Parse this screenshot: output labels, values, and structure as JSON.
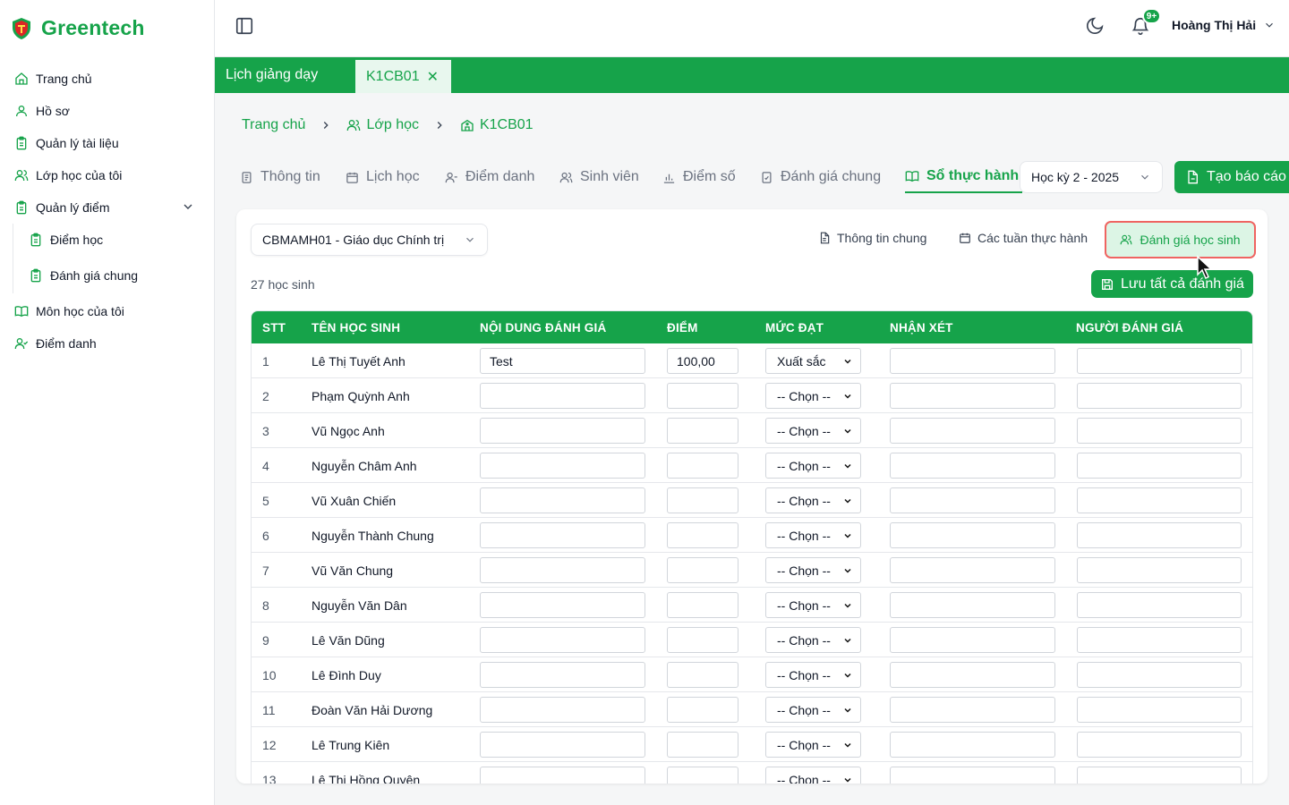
{
  "app": {
    "brand": "Greentech"
  },
  "sidebar": {
    "items": [
      {
        "label": "Trang chủ",
        "icon": "home-icon"
      },
      {
        "label": "Hồ sơ",
        "icon": "user-icon"
      },
      {
        "label": "Quản lý tài liệu",
        "icon": "clipboard-icon"
      },
      {
        "label": "Lớp học của tôi",
        "icon": "users-icon"
      },
      {
        "label": "Quản lý điểm",
        "icon": "clipboard-icon"
      },
      {
        "label": "Điểm học",
        "icon": "clipboard-icon"
      },
      {
        "label": "Đánh giá chung",
        "icon": "clipboard-icon"
      },
      {
        "label": "Môn học của tôi",
        "icon": "book-open-icon"
      },
      {
        "label": "Điểm danh",
        "icon": "user-check-icon"
      }
    ]
  },
  "header": {
    "user_name": "Hoàng Thị Hải",
    "notification_badge": "9+"
  },
  "tabbar": {
    "tabs": [
      {
        "label": "Lịch giảng dạy"
      },
      {
        "label": "K1CB01"
      }
    ]
  },
  "breadcrumb": {
    "items": [
      "Trang chủ",
      "Lớp học",
      "K1CB01"
    ]
  },
  "subtabs": {
    "items": [
      "Thông tin",
      "Lịch học",
      "Điểm danh",
      "Sinh viên",
      "Điểm số",
      "Đánh giá chung",
      "Sổ thực hành"
    ],
    "active": "Sổ thực hành"
  },
  "semester": {
    "value": "Học kỳ 2 - 2025"
  },
  "create_report": {
    "label": "Tạo báo cáo"
  },
  "card": {
    "subject": "CBMAMH01 - Giáo dục Chính trị",
    "general_info": "Thông tin chung",
    "practice_weeks": "Các tuần thực hành",
    "evaluate_students": "Đánh giá học sinh",
    "student_count": "27 học sinh",
    "save_all": "Lưu tất cả đánh giá"
  },
  "table": {
    "headers": [
      "STT",
      "TÊN HỌC SINH",
      "NỘI DUNG ĐÁNH GIÁ",
      "ĐIỂM",
      "MỨC ĐẠT",
      "NHẬN XÉT",
      "NGƯỜI ĐÁNH GIÁ"
    ],
    "rows": [
      {
        "stt": "1",
        "name": "Lê Thị Tuyết Anh",
        "content": "Test",
        "score": "100,00",
        "level": "Xuất sắc",
        "comment": "",
        "evaluator": ""
      },
      {
        "stt": "2",
        "name": "Phạm Quỳnh Anh",
        "content": "",
        "score": "",
        "level": "-- Chọn --",
        "comment": "",
        "evaluator": ""
      },
      {
        "stt": "3",
        "name": "Vũ Ngọc Anh",
        "content": "",
        "score": "",
        "level": "-- Chọn --",
        "comment": "",
        "evaluator": ""
      },
      {
        "stt": "4",
        "name": "Nguyễn Châm Anh",
        "content": "",
        "score": "",
        "level": "-- Chọn --",
        "comment": "",
        "evaluator": ""
      },
      {
        "stt": "5",
        "name": "Vũ Xuân Chiến",
        "content": "",
        "score": "",
        "level": "-- Chọn --",
        "comment": "",
        "evaluator": ""
      },
      {
        "stt": "6",
        "name": "Nguyễn Thành Chung",
        "content": "",
        "score": "",
        "level": "-- Chọn --",
        "comment": "",
        "evaluator": ""
      },
      {
        "stt": "7",
        "name": "Vũ Văn Chung",
        "content": "",
        "score": "",
        "level": "-- Chọn --",
        "comment": "",
        "evaluator": ""
      },
      {
        "stt": "8",
        "name": "Nguyễn Văn Dân",
        "content": "",
        "score": "",
        "level": "-- Chọn --",
        "comment": "",
        "evaluator": ""
      },
      {
        "stt": "9",
        "name": "Lê Văn Dũng",
        "content": "",
        "score": "",
        "level": "-- Chọn --",
        "comment": "",
        "evaluator": ""
      },
      {
        "stt": "10",
        "name": "Lê Đình Duy",
        "content": "",
        "score": "",
        "level": "-- Chọn --",
        "comment": "",
        "evaluator": ""
      },
      {
        "stt": "11",
        "name": "Đoàn Văn Hải Dương",
        "content": "",
        "score": "",
        "level": "-- Chọn --",
        "comment": "",
        "evaluator": ""
      },
      {
        "stt": "12",
        "name": "Lê Trung Kiên",
        "content": "",
        "score": "",
        "level": "-- Chọn --",
        "comment": "",
        "evaluator": ""
      },
      {
        "stt": "13",
        "name": "Lê Thị Hồng Quyên",
        "content": "",
        "score": "",
        "level": "-- Chọn --",
        "comment": "",
        "evaluator": ""
      }
    ]
  },
  "colors": {
    "accent": "#16a34a",
    "highlight_border": "#ef6461",
    "highlight_bg": "#dcf5e5"
  }
}
